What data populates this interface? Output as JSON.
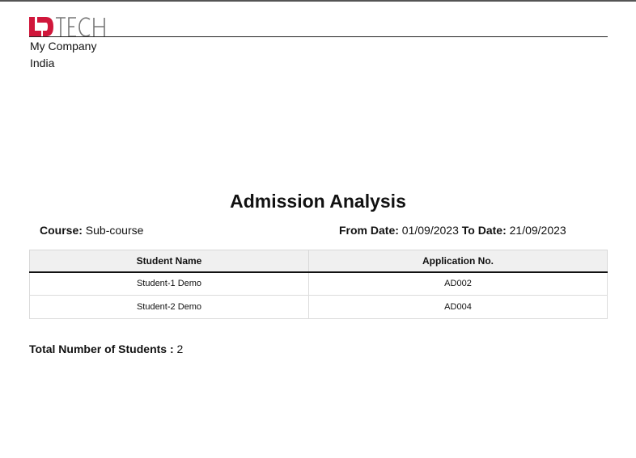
{
  "company": {
    "logo_text": "LDTECH",
    "name": "My Company",
    "country": "India",
    "colors": {
      "logo_red": "#d0173b",
      "logo_gray": "#777777"
    }
  },
  "report": {
    "title": "Admission Analysis",
    "course_label": "Course:",
    "course_value": "Sub-course",
    "from_label": "From Date:",
    "from_value": "01/09/2023",
    "to_label": "To Date:",
    "to_value": "21/09/2023"
  },
  "table": {
    "headers": [
      "Student Name",
      "Application No."
    ],
    "rows": [
      [
        "Student-1 Demo",
        "AD002"
      ],
      [
        "Student-2 Demo",
        "AD004"
      ]
    ]
  },
  "summary": {
    "total_label": "Total Number of Students :",
    "total_value": "2"
  }
}
